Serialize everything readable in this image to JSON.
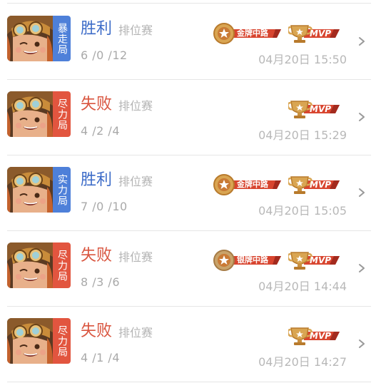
{
  "matches": [
    {
      "mode_tag": "暴走局",
      "tag_color": "#4e80d9",
      "result": "胜利",
      "result_color": "#3d6cc8",
      "match_type": "排位赛",
      "kda": "6 /0 /12",
      "time": "04月20日 15:50",
      "medal": "金牌中路",
      "mvp": "MVP"
    },
    {
      "mode_tag": "尽力局",
      "tag_color": "#e2553f",
      "result": "失败",
      "result_color": "#d9553f",
      "match_type": "排位赛",
      "kda": "4 /2 /4",
      "time": "04月20日 15:29",
      "medal": null,
      "mvp": "MVP"
    },
    {
      "mode_tag": "实力局",
      "tag_color": "#4e80d9",
      "result": "胜利",
      "result_color": "#3d6cc8",
      "match_type": "排位赛",
      "kda": "7 /0 /10",
      "time": "04月20日 15:05",
      "medal": "金牌中路",
      "mvp": "MVP"
    },
    {
      "mode_tag": "尽力局",
      "tag_color": "#e2553f",
      "result": "失败",
      "result_color": "#d9553f",
      "match_type": "排位赛",
      "kda": "8 /3 /6",
      "time": "04月20日 14:44",
      "medal": "银牌中路",
      "mvp": "MVP"
    },
    {
      "mode_tag": "尽力局",
      "tag_color": "#e2553f",
      "result": "失败",
      "result_color": "#d9553f",
      "match_type": "排位赛",
      "kda": "4 /1 /4",
      "time": "04月20日 14:27",
      "medal": null,
      "mvp": "MVP"
    }
  ],
  "icons": {
    "avatar": "hero-avatar",
    "medal": "medal-icon",
    "mvp": "trophy-icon",
    "arrow": "chevron-right-icon"
  }
}
